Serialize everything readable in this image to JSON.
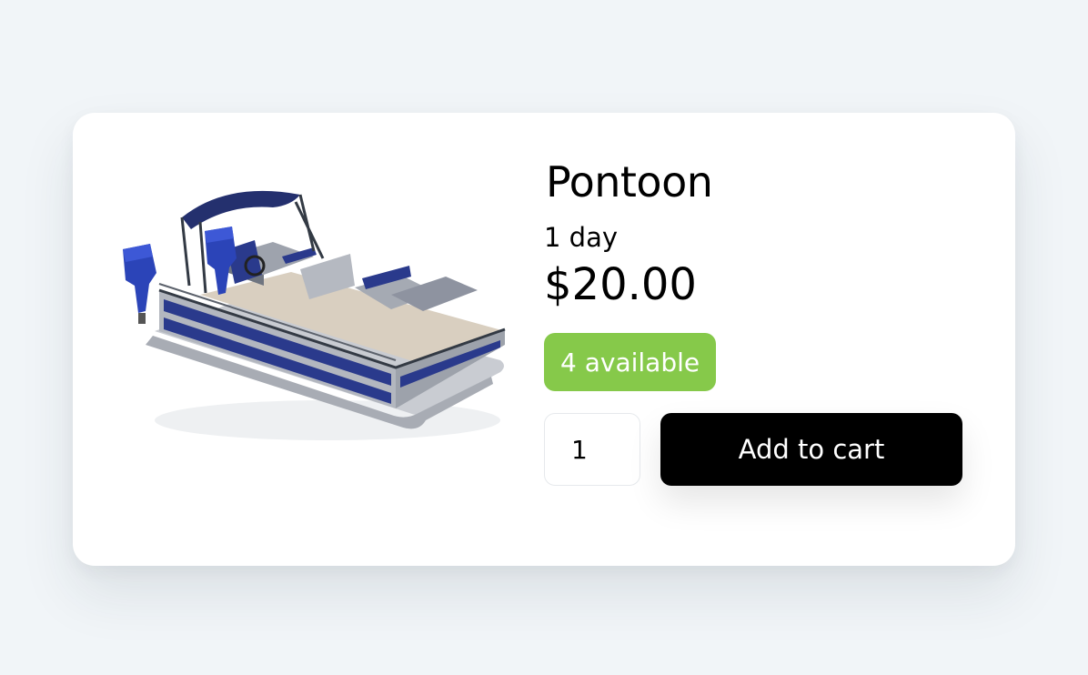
{
  "product": {
    "name": "Pontoon",
    "duration": "1 day",
    "price": "$20.00",
    "availability": "4 available",
    "image_icon": "pontoon-boat-image"
  },
  "cart": {
    "quantity": "1",
    "add_label": "Add to cart"
  },
  "colors": {
    "available_badge": "#86c94a",
    "button": "#000000",
    "background": "#f1f5f8",
    "boat_blue": "#2a3a8c"
  }
}
